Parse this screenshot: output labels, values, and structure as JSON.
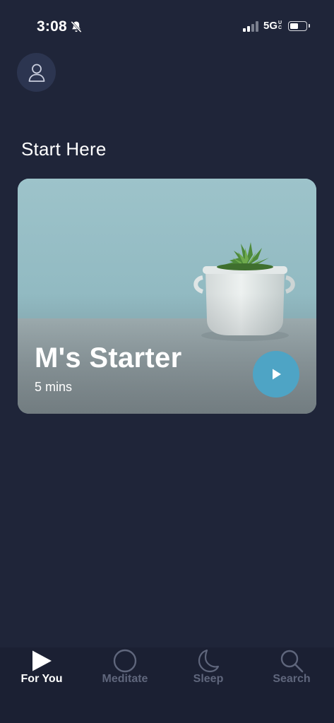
{
  "status_bar": {
    "time": "3:08",
    "network": "5G",
    "network_superscript": "UC",
    "battery_level": 0.45
  },
  "header": {
    "profile_icon": "person-icon"
  },
  "main": {
    "section_title": "Start Here",
    "featured_card": {
      "title": "M's Starter",
      "duration": "5 mins",
      "play_icon": "play-icon"
    }
  },
  "tab_bar": {
    "tabs": [
      {
        "label": "For You",
        "icon": "play-icon",
        "active": true
      },
      {
        "label": "Meditate",
        "icon": "circle-icon",
        "active": false
      },
      {
        "label": "Sleep",
        "icon": "moon-icon",
        "active": false
      },
      {
        "label": "Search",
        "icon": "search-icon",
        "active": false
      }
    ]
  },
  "colors": {
    "background": "#1f2539",
    "accent": "#4ea4c5",
    "inactive_tab": "#5f667c",
    "tab_bar": "#1b2033"
  }
}
